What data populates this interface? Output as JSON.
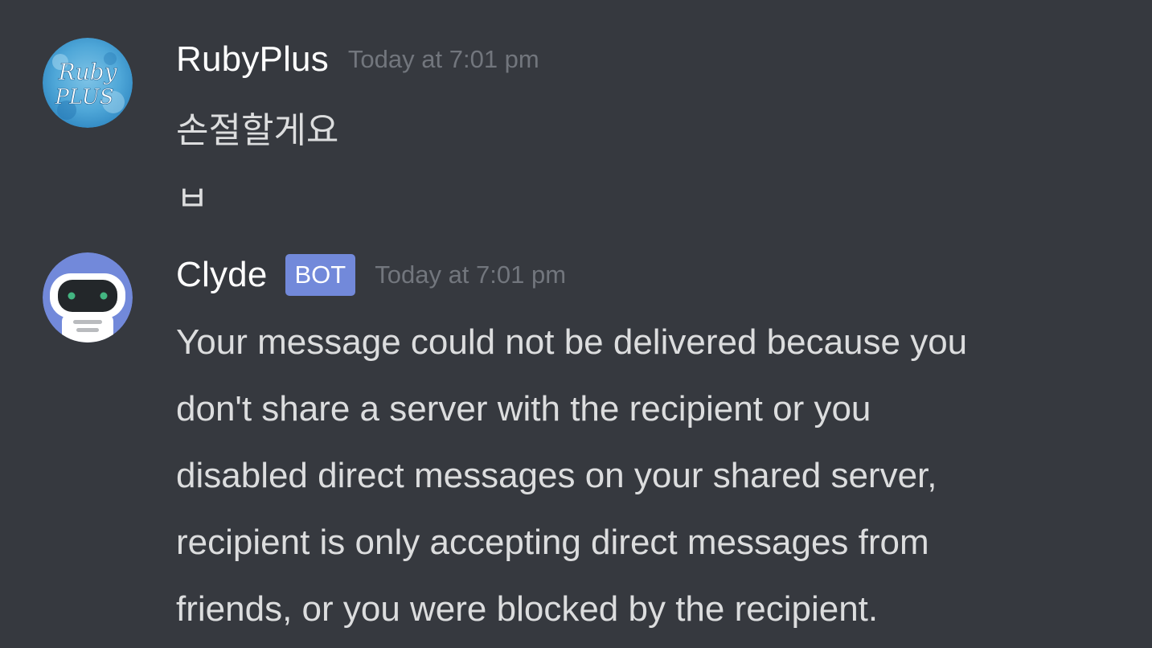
{
  "messages": [
    {
      "author": "RubyPlus",
      "timestamp": "Today at 7:01 pm",
      "avatar_text": [
        "Ruby",
        "PLUS"
      ],
      "lines": [
        "손절할게요",
        "ㅂ"
      ]
    },
    {
      "author": "Clyde",
      "badge": "BOT",
      "timestamp": "Today at 7:01 pm",
      "avatar_icon": "robot-icon",
      "lines": [
        "Your message could not be delivered because you",
        "don't share a server with the recipient or you",
        "disabled direct messages on your shared server,",
        "recipient is only accepting direct messages from",
        "friends, or you were blocked by the recipient."
      ]
    }
  ],
  "colors": {
    "background": "#36393f",
    "username": "#ffffff",
    "timestamp": "#72767d",
    "message_text": "#dcddde",
    "bot_badge": "#7289da",
    "clyde_avatar": "#7289da"
  }
}
